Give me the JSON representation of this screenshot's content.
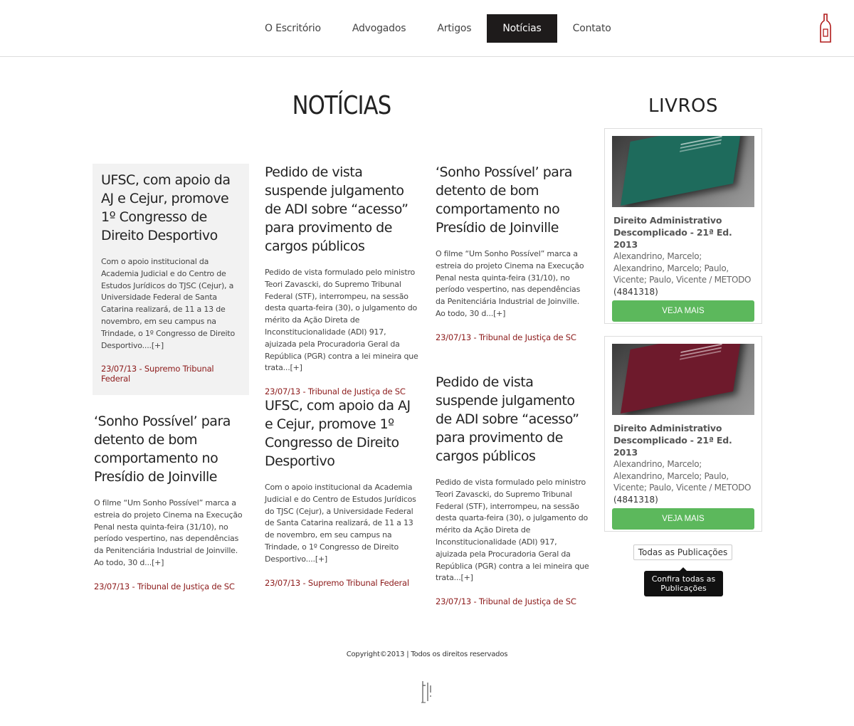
{
  "nav": {
    "items": [
      {
        "label": "O Escritório"
      },
      {
        "label": "Advogados"
      },
      {
        "label": "Artigos"
      },
      {
        "label": "Notícias"
      },
      {
        "label": "Contato"
      }
    ]
  },
  "main": {
    "title": "NOTÍCIAS",
    "articles": [
      {
        "title": "UFSC, com apoio da AJ e Cejur, promove 1º Congresso de Direito Desportivo",
        "body": "Com o apoio institucional da Academia Judicial e do Centro de Estudos Jurídicos do TJSC (Cejur), a Universidade Federal de Santa Catarina realizará, de 11 a 13 de novembro, em seu campus na Trindade, o 1º Congresso de Direito Desportivo....",
        "more": "[+]",
        "meta": "23/07/13 - Supremo Tribunal Federal"
      },
      {
        "title": "Pedido de vista suspende julgamento de ADI sobre “acesso” para provimento de cargos públicos",
        "body": "Pedido de vista formulado pelo ministro Teori Zavascki, do Supremo Tribunal Federal (STF), interrompeu, na sessão desta quarta-feira (30), o julgamento do mérito da Ação Direta de Inconstitucionalidade (ADI) 917, ajuizada pela Procuradoria Geral da República (PGR) contra a lei mineira que trata...",
        "more": "[+]",
        "meta": "23/07/13 - Tribunal de Justiça de SC"
      },
      {
        "title": "‘Sonho Possível’ para detento de bom comportamento no Presídio de Joinville",
        "body": "O filme “Um Sonho Possível” marca a estreia do projeto Cinema na Execução Penal nesta quinta-feira (31/10), no período vespertino, nas dependências da Penitenciária Industrial de Joinville. Ao todo, 30 d...",
        "more": "[+]",
        "meta": "23/07/13 - Tribunal de Justiça de SC"
      },
      {
        "title": "‘Sonho Possível’ para detento de bom comportamento no Presídio de Joinville",
        "body": "O filme “Um Sonho Possível” marca a estreia do projeto Cinema na Execução Penal nesta quinta-feira (31/10), no período vespertino, nas dependências da Penitenciária Industrial de Joinville. Ao todo, 30 d...",
        "more": "[+]",
        "meta": "23/07/13 - Tribunal de Justiça de SC"
      },
      {
        "title": "UFSC, com apoio da AJ e Cejur, promove 1º Congresso de Direito Desportivo",
        "body": "Com o apoio institucional da Academia Judicial e do Centro de Estudos Jurídicos do TJSC (Cejur), a Universidade Federal de Santa Catarina realizará, de 11 a 13 de novembro, em seu campus na Trindade, o 1º Congresso de Direito Desportivo....",
        "more": "[+]",
        "meta": "23/07/13 - Supremo Tribunal Federal"
      },
      {
        "title": "Pedido de vista suspende julgamento de ADI sobre “acesso” para provimento de cargos públicos",
        "body": "Pedido de vista formulado pelo ministro Teori Zavascki, do Supremo Tribunal Federal (STF), interrompeu, na sessão desta quarta-feira (30), o julgamento do mérito da Ação Direta de Inconstitucionalidade (ADI) 917, ajuizada pela Procuradoria Geral da República (PGR) contra a lei mineira que trata...",
        "more": "[+]",
        "meta": "23/07/13 - Tribunal de Justiça de SC"
      }
    ]
  },
  "sidebar": {
    "title": "LIVROS",
    "books": [
      {
        "name": "Direito Administrativo Descomplicado - 21ª Ed. 2013",
        "authors": "Alexandrino, Marcelo; Alexandrino, Marcelo; Paulo, Vicente; Paulo, Vicente / METODO",
        "code": "(4841318)",
        "button": "VEJA MAIS",
        "cover_color": "#1e6b5c"
      },
      {
        "name": "Direito Administrativo Descomplicado - 21ª Ed. 2013",
        "authors": "Alexandrino, Marcelo; Alexandrino, Marcelo; Paulo, Vicente; Paulo, Vicente / METODO",
        "code": "(4841318)",
        "button": "VEJA MAIS",
        "cover_color": "#6e1a2c"
      }
    ],
    "all_button": "Todas as Publicações",
    "tooltip": "Confira todas as Publicações"
  },
  "footer": {
    "copyright": "Copyright©2013 | Todos os direitos reservados"
  },
  "colors": {
    "accent": "#8c1a1a",
    "nav_active": "#1e1b1b",
    "button": "#5cb85c"
  }
}
